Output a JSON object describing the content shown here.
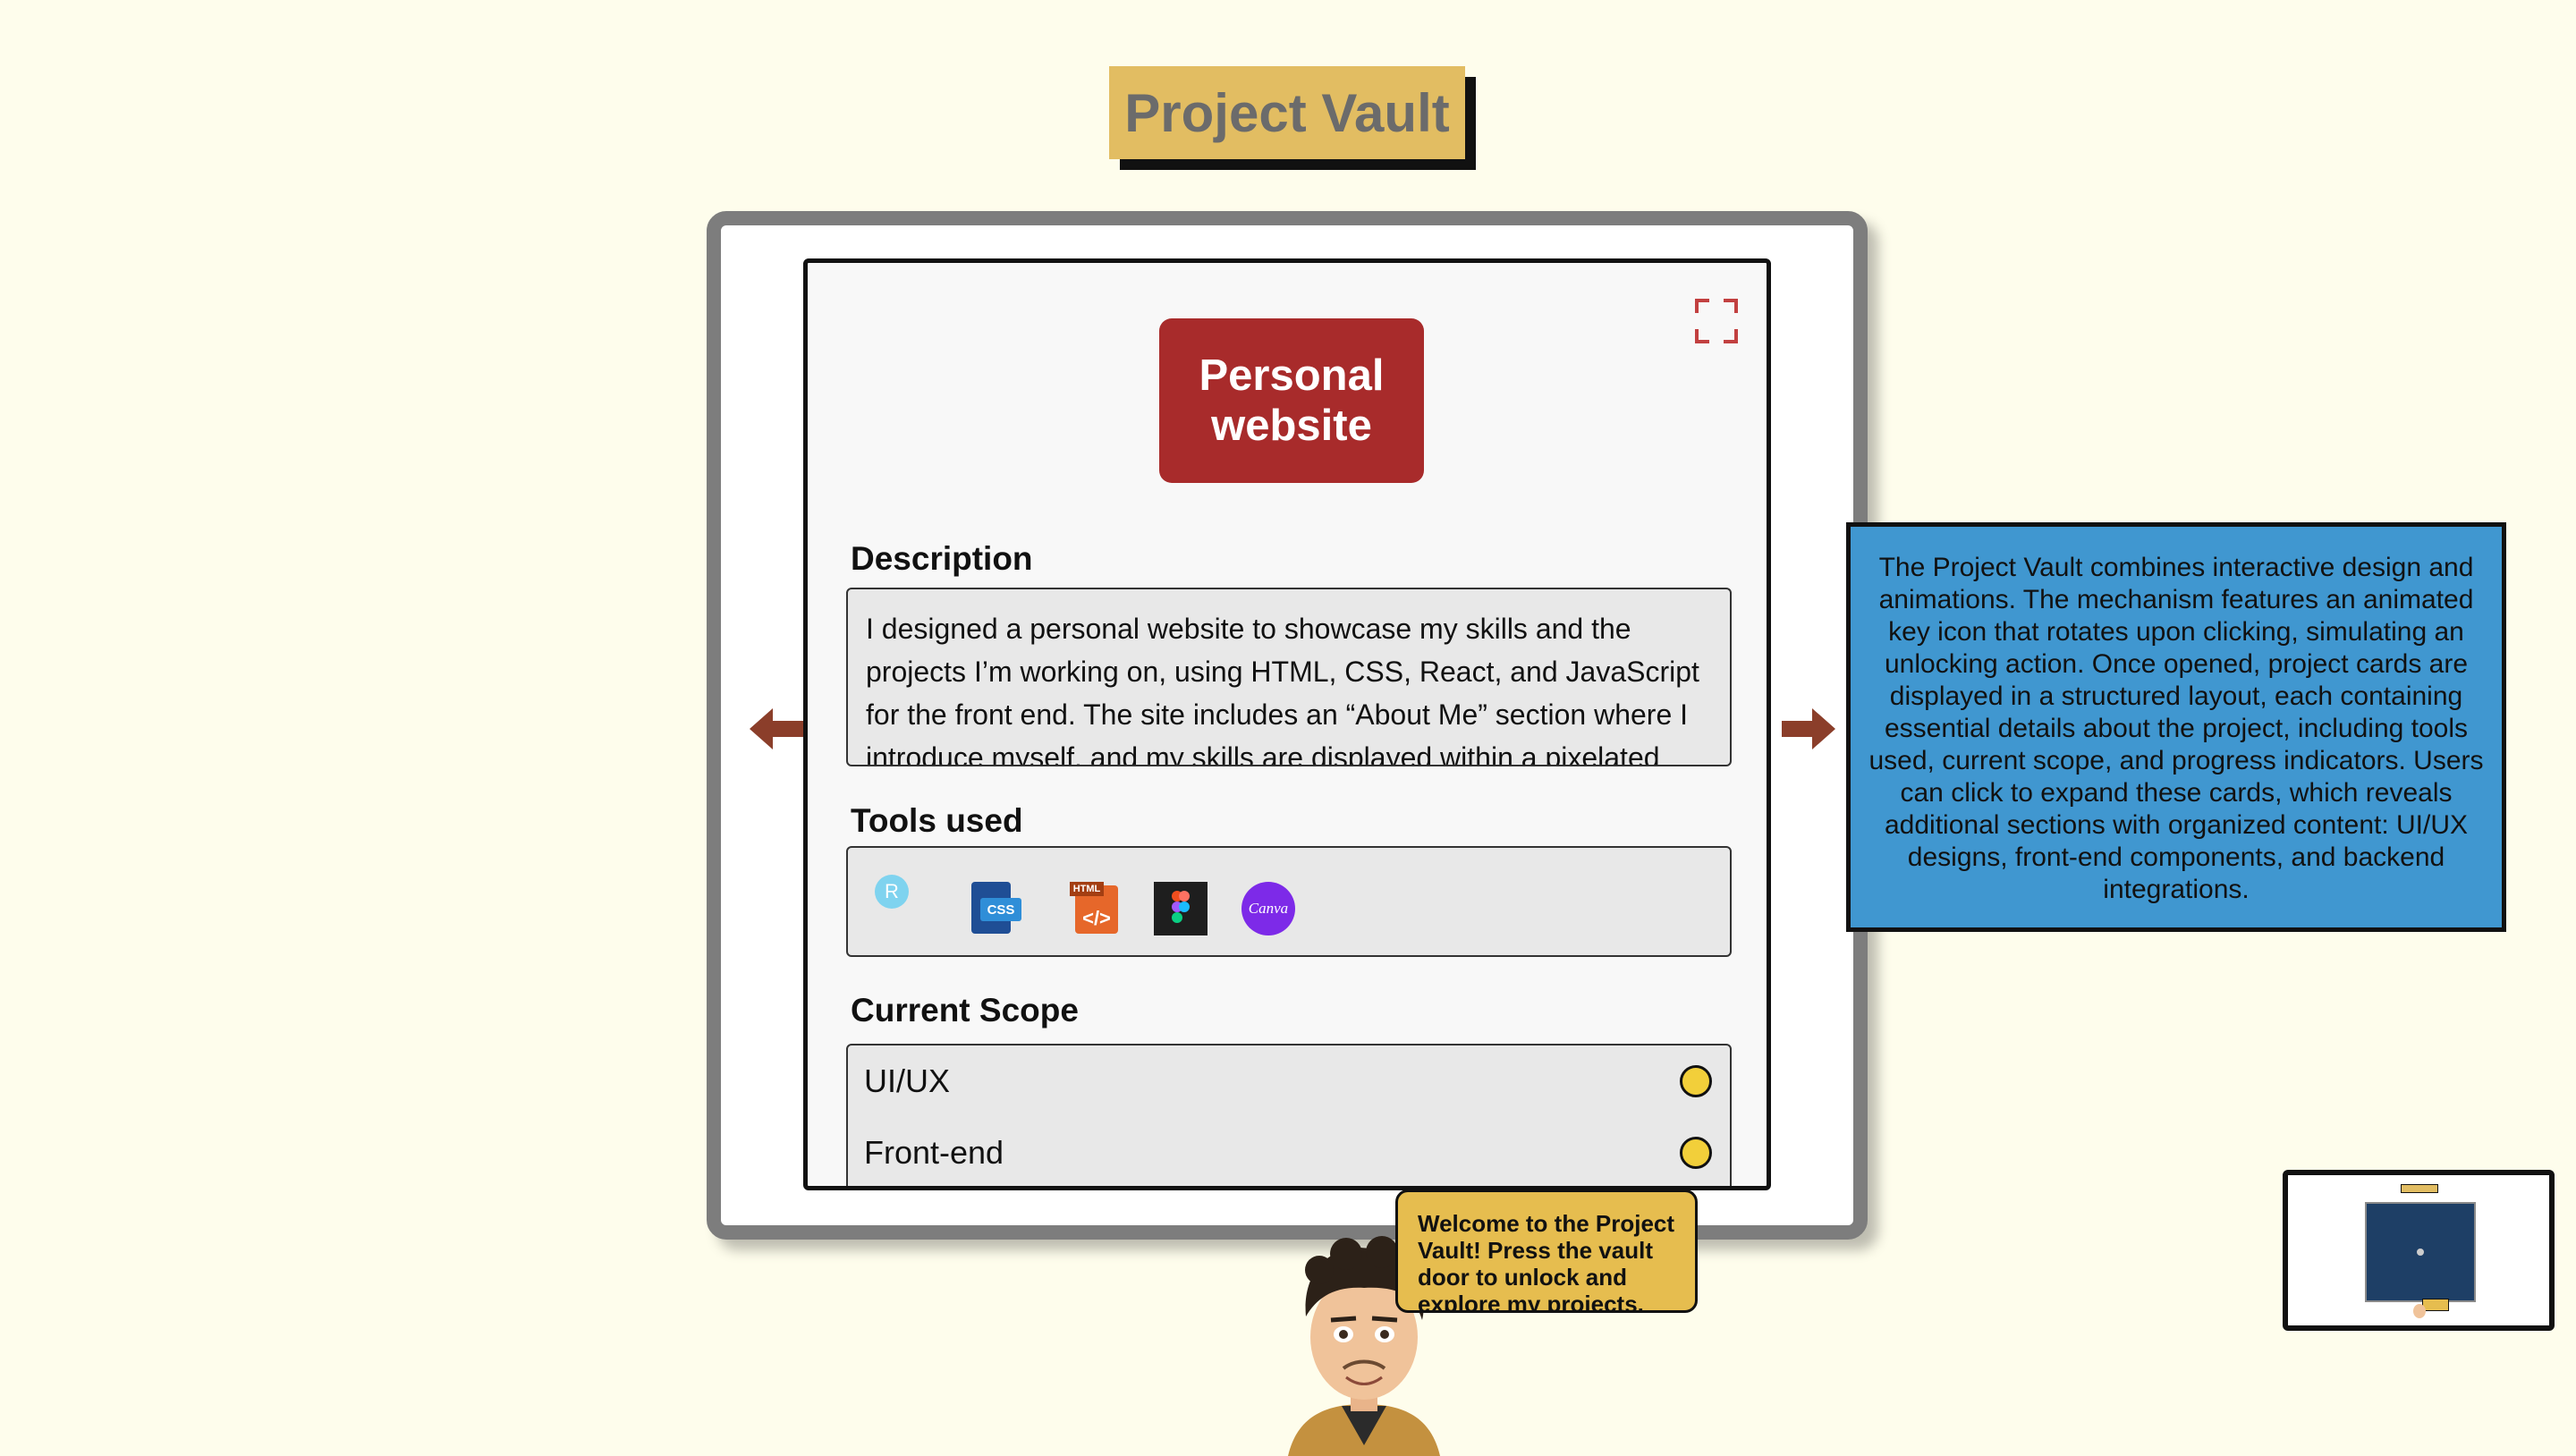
{
  "header": {
    "title": "Project Vault"
  },
  "card": {
    "title": "Personal website",
    "description_label": "Description",
    "description": "I designed a personal website to showcase my skills and the projects I’m working on, using HTML, CSS, React, and JavaScript for the front end. The site includes an “About Me” section where I introduce myself, and my skills are displayed within a pixelated",
    "tools_label": "Tools used",
    "tools": [
      {
        "icon": "react-icon",
        "text": "R"
      },
      {
        "icon": "css-icon",
        "text": "CSS"
      },
      {
        "icon": "html-icon",
        "text": "HTML"
      },
      {
        "icon": "figma-icon"
      },
      {
        "icon": "canva-icon",
        "text": "Canva"
      }
    ],
    "scope_label": "Current Scope",
    "scope": [
      {
        "label": "UI/UX"
      },
      {
        "label": "Front-end"
      }
    ]
  },
  "info": {
    "text": "The Project Vault combines interactive design and animations. The mechanism features an animated key icon that rotates upon clicking, simulating an unlocking action. Once opened, project cards are displayed in a structured layout, each containing essential details about the project, including tools used, current scope, and progress indicators. Users can click to expand these cards, which reveals additional sections with organized content: UI/UX designs, front-end components, and backend integrations."
  },
  "guide": {
    "message": "Welcome to the Project Vault! Press the vault door to unlock and explore my projects."
  },
  "colors": {
    "background": "#fefdec",
    "banner": "#e2bd62",
    "card_title": "#a82b2b",
    "info_box": "#4097d0",
    "speech": "#e6bd4f",
    "arrow": "#8b3e2a",
    "scope_dot": "#f2cf3a"
  }
}
